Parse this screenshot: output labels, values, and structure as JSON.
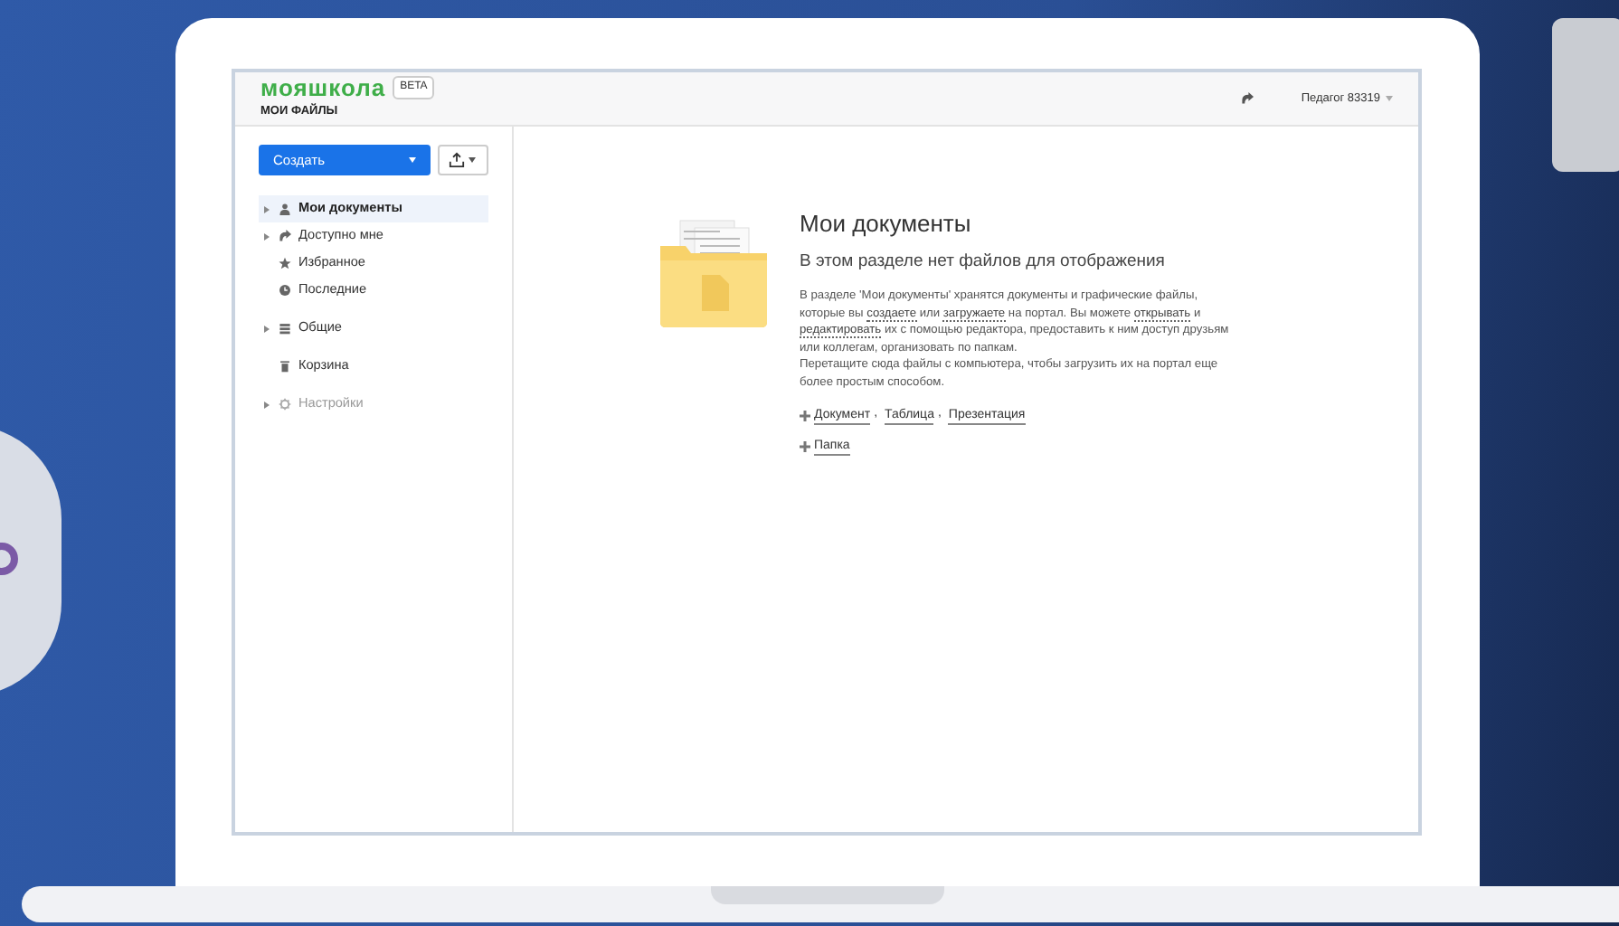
{
  "header": {
    "logo": "мояшкола",
    "badge": "BETA",
    "subtitle": "МОИ ФАЙЛЫ",
    "user": "Педагог 83319"
  },
  "sidebar": {
    "create_button": "Создать",
    "groups": [
      [
        {
          "label": "Мои документы",
          "kind": "person",
          "expandable": true,
          "selected": true,
          "disabled": false
        },
        {
          "label": "Доступно мне",
          "kind": "share",
          "expandable": true,
          "selected": false,
          "disabled": false
        },
        {
          "label": "Избранное",
          "kind": "star",
          "expandable": false,
          "selected": false,
          "disabled": false
        },
        {
          "label": "Последние",
          "kind": "clock",
          "expandable": false,
          "selected": false,
          "disabled": false
        }
      ],
      [
        {
          "label": "Общие",
          "kind": "stack",
          "expandable": true,
          "selected": false,
          "disabled": false
        }
      ],
      [
        {
          "label": "Корзина",
          "kind": "trash",
          "expandable": false,
          "selected": false,
          "disabled": false
        }
      ],
      [
        {
          "label": "Настройки",
          "kind": "gear",
          "expandable": true,
          "selected": false,
          "disabled": true
        }
      ]
    ]
  },
  "empty_state": {
    "title": "Мои документы",
    "subtitle": "В этом разделе нет файлов для отображения",
    "paragraphs": [
      [
        {
          "kind": "text",
          "text": "В разделе 'Мои документы' хранятся документы и графические файлы, которые вы "
        },
        {
          "kind": "link",
          "text": "создаете"
        },
        {
          "kind": "text",
          "text": " или "
        },
        {
          "kind": "link",
          "text": "загружаете"
        },
        {
          "kind": "text",
          "text": " на портал. Вы можете "
        },
        {
          "kind": "link",
          "text": "открывать"
        },
        {
          "kind": "text",
          "text": " и "
        },
        {
          "kind": "link",
          "text": "редактировать"
        },
        {
          "kind": "text",
          "text": " их с помощью редактора, предоставить к ним доступ друзьям или коллегам, организовать по папкам."
        }
      ],
      [
        {
          "kind": "text",
          "text": "Перетащите сюда файлы с компьютера, чтобы загрузить их на портал еще более простым способом."
        }
      ]
    ],
    "actions": [
      {
        "links": [
          "Документ",
          "Таблица",
          "Презентация"
        ],
        "separator": ","
      },
      {
        "links": [
          "Папка"
        ]
      }
    ]
  }
}
